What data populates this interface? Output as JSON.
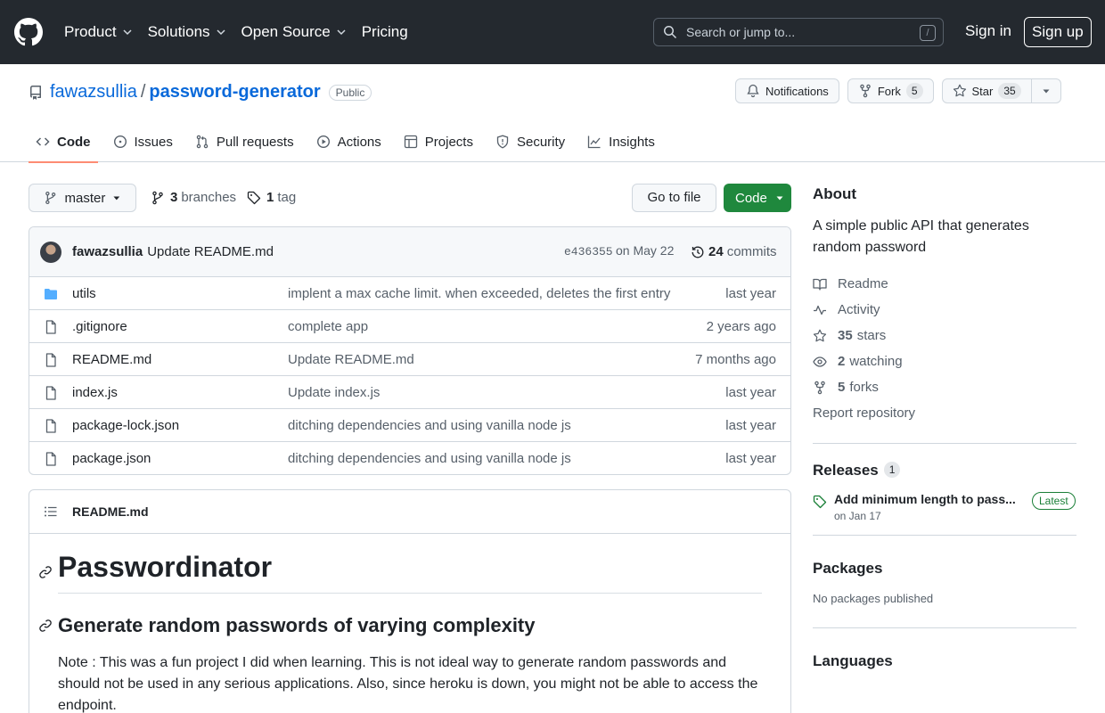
{
  "header": {
    "nav": [
      {
        "label": "Product",
        "has_menu": true
      },
      {
        "label": "Solutions",
        "has_menu": true
      },
      {
        "label": "Open Source",
        "has_menu": true
      },
      {
        "label": "Pricing",
        "has_menu": false
      }
    ],
    "search_placeholder": "Search or jump to...",
    "search_key": "/",
    "sign_in": "Sign in",
    "sign_up": "Sign up"
  },
  "repo": {
    "owner": "fawazsullia",
    "separator": "/",
    "name": "password-generator",
    "visibility": "Public",
    "notifications_label": "Notifications",
    "fork_label": "Fork",
    "fork_count": "5",
    "star_label": "Star",
    "star_count": "35",
    "tabs": [
      {
        "label": "Code",
        "icon": "code-icon",
        "active": true
      },
      {
        "label": "Issues",
        "icon": "issue-icon"
      },
      {
        "label": "Pull requests",
        "icon": "pull-request-icon"
      },
      {
        "label": "Actions",
        "icon": "play-icon"
      },
      {
        "label": "Projects",
        "icon": "table-icon"
      },
      {
        "label": "Security",
        "icon": "shield-icon"
      },
      {
        "label": "Insights",
        "icon": "graph-icon"
      }
    ]
  },
  "toolbar": {
    "branch": "master",
    "branches_count": "3",
    "branches_label": "branches",
    "tags_count": "1",
    "tags_label": "tag",
    "go_to_file": "Go to file",
    "code_button": "Code"
  },
  "commit": {
    "author": "fawazsullia",
    "message": "Update README.md",
    "hash": "e436355",
    "date": "on May 22",
    "count": "24",
    "count_label": "commits"
  },
  "files": [
    {
      "name": "utils",
      "type": "folder",
      "message": "implent a max cache limit. when exceeded, deletes the first entry",
      "age": "last year"
    },
    {
      "name": ".gitignore",
      "type": "file",
      "message": "complete app",
      "age": "2 years ago"
    },
    {
      "name": "README.md",
      "type": "file",
      "message": "Update README.md",
      "age": "7 months ago"
    },
    {
      "name": "index.js",
      "type": "file",
      "message": "Update index.js",
      "age": "last year"
    },
    {
      "name": "package-lock.json",
      "type": "file",
      "message": "ditching dependencies and using vanilla node js",
      "age": "last year"
    },
    {
      "name": "package.json",
      "type": "file",
      "message": "ditching dependencies and using vanilla node js",
      "age": "last year"
    }
  ],
  "readme": {
    "filename": "README.md",
    "h1": "Passwordinator",
    "h2": "Generate random passwords of varying complexity",
    "note": "Note : This was a fun project I did when learning. This is not ideal way to generate random passwords and should not be used in any serious applications. Also, since heroku is down, you might not be able to access the endpoint."
  },
  "about": {
    "title": "About",
    "description": "A simple public API that generates random password",
    "readme_label": "Readme",
    "activity_label": "Activity",
    "stars_count": "35",
    "stars_label": "stars",
    "watching_count": "2",
    "watching_label": "watching",
    "forks_count": "5",
    "forks_label": "forks",
    "report_label": "Report repository"
  },
  "releases": {
    "title": "Releases",
    "count": "1",
    "latest_title": "Add minimum length to pass...",
    "latest_date": "on Jan 17",
    "latest_badge": "Latest"
  },
  "packages": {
    "title": "Packages",
    "empty": "No packages published"
  },
  "languages": {
    "title": "Languages"
  },
  "colors": {
    "header_bg": "#24292f",
    "link": "#0969da",
    "primary_button": "#1f883d",
    "active_tab_underline": "#fd8c73",
    "folder_icon": "#54aeff"
  }
}
